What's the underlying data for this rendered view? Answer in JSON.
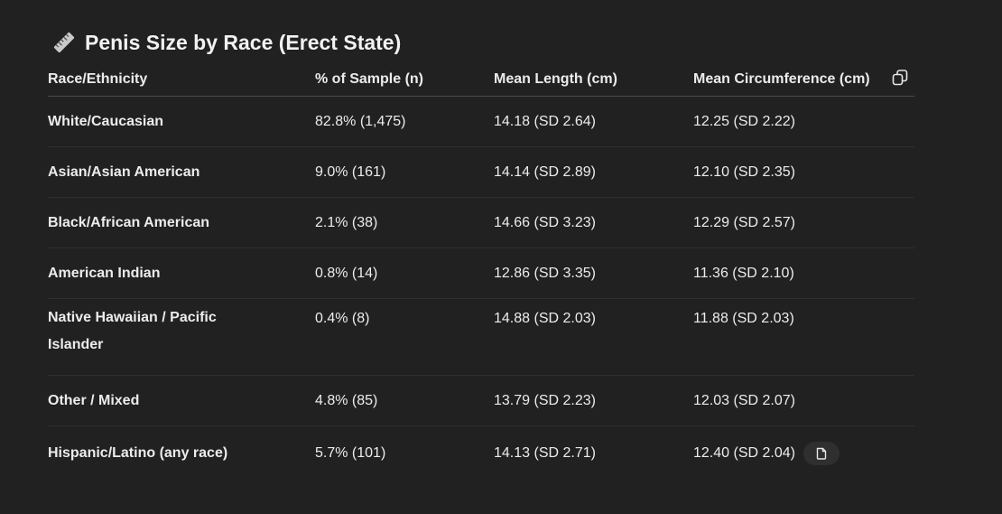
{
  "title": {
    "icon": "ruler-icon",
    "text": "Penis Size by Race (Erect State)"
  },
  "table": {
    "headers": [
      "Race/Ethnicity",
      "% of Sample (n)",
      "Mean Length (cm)",
      "Mean Circumference (cm)"
    ],
    "copy_icon": "copy-icon",
    "rows": [
      {
        "race": "White/Caucasian",
        "sample": "82.8% (1,475)",
        "length": "14.18 (SD 2.64)",
        "circumference": "12.25 (SD 2.22)"
      },
      {
        "race": "Asian/Asian American",
        "sample": "9.0% (161)",
        "length": "14.14 (SD 2.89)",
        "circumference": "12.10 (SD 2.35)"
      },
      {
        "race": "Black/African American",
        "sample": "2.1% (38)",
        "length": "14.66 (SD 3.23)",
        "circumference": "12.29 (SD 2.57)"
      },
      {
        "race": "American Indian",
        "sample": "0.8% (14)",
        "length": "12.86 (SD 3.35)",
        "circumference": "11.36 (SD 2.10)"
      },
      {
        "race": "Native Hawaiian / Pacific Islander",
        "sample": "0.4% (8)",
        "length": "14.88 (SD 2.03)",
        "circumference": "11.88 (SD 2.03)"
      },
      {
        "race": "Other / Mixed",
        "sample": "4.8% (85)",
        "length": "13.79 (SD 2.23)",
        "circumference": "12.03 (SD 2.07)"
      },
      {
        "race": "Hispanic/Latino (any race)",
        "sample": "5.7% (101)",
        "length": "14.13 (SD 2.71)",
        "circumference": "12.40 (SD 2.04)"
      }
    ],
    "cell_copy_icon": "copy-cell-icon"
  }
}
